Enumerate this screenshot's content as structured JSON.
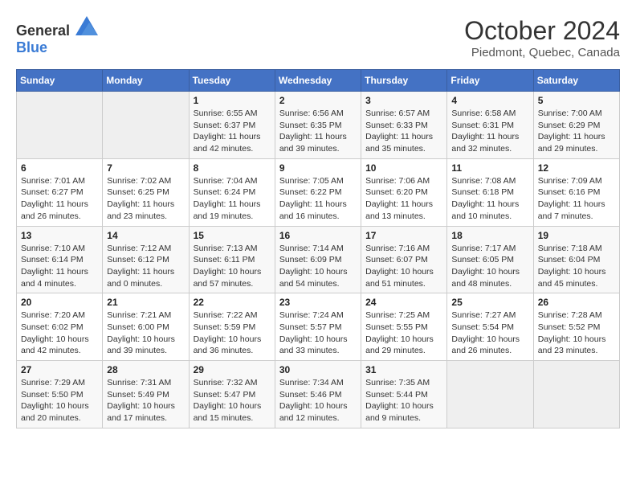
{
  "header": {
    "logo_general": "General",
    "logo_blue": "Blue",
    "month": "October 2024",
    "location": "Piedmont, Quebec, Canada"
  },
  "weekdays": [
    "Sunday",
    "Monday",
    "Tuesday",
    "Wednesday",
    "Thursday",
    "Friday",
    "Saturday"
  ],
  "weeks": [
    [
      {
        "day": "",
        "sunrise": "",
        "sunset": "",
        "daylight": ""
      },
      {
        "day": "",
        "sunrise": "",
        "sunset": "",
        "daylight": ""
      },
      {
        "day": "1",
        "sunrise": "Sunrise: 6:55 AM",
        "sunset": "Sunset: 6:37 PM",
        "daylight": "Daylight: 11 hours and 42 minutes."
      },
      {
        "day": "2",
        "sunrise": "Sunrise: 6:56 AM",
        "sunset": "Sunset: 6:35 PM",
        "daylight": "Daylight: 11 hours and 39 minutes."
      },
      {
        "day": "3",
        "sunrise": "Sunrise: 6:57 AM",
        "sunset": "Sunset: 6:33 PM",
        "daylight": "Daylight: 11 hours and 35 minutes."
      },
      {
        "day": "4",
        "sunrise": "Sunrise: 6:58 AM",
        "sunset": "Sunset: 6:31 PM",
        "daylight": "Daylight: 11 hours and 32 minutes."
      },
      {
        "day": "5",
        "sunrise": "Sunrise: 7:00 AM",
        "sunset": "Sunset: 6:29 PM",
        "daylight": "Daylight: 11 hours and 29 minutes."
      }
    ],
    [
      {
        "day": "6",
        "sunrise": "Sunrise: 7:01 AM",
        "sunset": "Sunset: 6:27 PM",
        "daylight": "Daylight: 11 hours and 26 minutes."
      },
      {
        "day": "7",
        "sunrise": "Sunrise: 7:02 AM",
        "sunset": "Sunset: 6:25 PM",
        "daylight": "Daylight: 11 hours and 23 minutes."
      },
      {
        "day": "8",
        "sunrise": "Sunrise: 7:04 AM",
        "sunset": "Sunset: 6:24 PM",
        "daylight": "Daylight: 11 hours and 19 minutes."
      },
      {
        "day": "9",
        "sunrise": "Sunrise: 7:05 AM",
        "sunset": "Sunset: 6:22 PM",
        "daylight": "Daylight: 11 hours and 16 minutes."
      },
      {
        "day": "10",
        "sunrise": "Sunrise: 7:06 AM",
        "sunset": "Sunset: 6:20 PM",
        "daylight": "Daylight: 11 hours and 13 minutes."
      },
      {
        "day": "11",
        "sunrise": "Sunrise: 7:08 AM",
        "sunset": "Sunset: 6:18 PM",
        "daylight": "Daylight: 11 hours and 10 minutes."
      },
      {
        "day": "12",
        "sunrise": "Sunrise: 7:09 AM",
        "sunset": "Sunset: 6:16 PM",
        "daylight": "Daylight: 11 hours and 7 minutes."
      }
    ],
    [
      {
        "day": "13",
        "sunrise": "Sunrise: 7:10 AM",
        "sunset": "Sunset: 6:14 PM",
        "daylight": "Daylight: 11 hours and 4 minutes."
      },
      {
        "day": "14",
        "sunrise": "Sunrise: 7:12 AM",
        "sunset": "Sunset: 6:12 PM",
        "daylight": "Daylight: 11 hours and 0 minutes."
      },
      {
        "day": "15",
        "sunrise": "Sunrise: 7:13 AM",
        "sunset": "Sunset: 6:11 PM",
        "daylight": "Daylight: 10 hours and 57 minutes."
      },
      {
        "day": "16",
        "sunrise": "Sunrise: 7:14 AM",
        "sunset": "Sunset: 6:09 PM",
        "daylight": "Daylight: 10 hours and 54 minutes."
      },
      {
        "day": "17",
        "sunrise": "Sunrise: 7:16 AM",
        "sunset": "Sunset: 6:07 PM",
        "daylight": "Daylight: 10 hours and 51 minutes."
      },
      {
        "day": "18",
        "sunrise": "Sunrise: 7:17 AM",
        "sunset": "Sunset: 6:05 PM",
        "daylight": "Daylight: 10 hours and 48 minutes."
      },
      {
        "day": "19",
        "sunrise": "Sunrise: 7:18 AM",
        "sunset": "Sunset: 6:04 PM",
        "daylight": "Daylight: 10 hours and 45 minutes."
      }
    ],
    [
      {
        "day": "20",
        "sunrise": "Sunrise: 7:20 AM",
        "sunset": "Sunset: 6:02 PM",
        "daylight": "Daylight: 10 hours and 42 minutes."
      },
      {
        "day": "21",
        "sunrise": "Sunrise: 7:21 AM",
        "sunset": "Sunset: 6:00 PM",
        "daylight": "Daylight: 10 hours and 39 minutes."
      },
      {
        "day": "22",
        "sunrise": "Sunrise: 7:22 AM",
        "sunset": "Sunset: 5:59 PM",
        "daylight": "Daylight: 10 hours and 36 minutes."
      },
      {
        "day": "23",
        "sunrise": "Sunrise: 7:24 AM",
        "sunset": "Sunset: 5:57 PM",
        "daylight": "Daylight: 10 hours and 33 minutes."
      },
      {
        "day": "24",
        "sunrise": "Sunrise: 7:25 AM",
        "sunset": "Sunset: 5:55 PM",
        "daylight": "Daylight: 10 hours and 29 minutes."
      },
      {
        "day": "25",
        "sunrise": "Sunrise: 7:27 AM",
        "sunset": "Sunset: 5:54 PM",
        "daylight": "Daylight: 10 hours and 26 minutes."
      },
      {
        "day": "26",
        "sunrise": "Sunrise: 7:28 AM",
        "sunset": "Sunset: 5:52 PM",
        "daylight": "Daylight: 10 hours and 23 minutes."
      }
    ],
    [
      {
        "day": "27",
        "sunrise": "Sunrise: 7:29 AM",
        "sunset": "Sunset: 5:50 PM",
        "daylight": "Daylight: 10 hours and 20 minutes."
      },
      {
        "day": "28",
        "sunrise": "Sunrise: 7:31 AM",
        "sunset": "Sunset: 5:49 PM",
        "daylight": "Daylight: 10 hours and 17 minutes."
      },
      {
        "day": "29",
        "sunrise": "Sunrise: 7:32 AM",
        "sunset": "Sunset: 5:47 PM",
        "daylight": "Daylight: 10 hours and 15 minutes."
      },
      {
        "day": "30",
        "sunrise": "Sunrise: 7:34 AM",
        "sunset": "Sunset: 5:46 PM",
        "daylight": "Daylight: 10 hours and 12 minutes."
      },
      {
        "day": "31",
        "sunrise": "Sunrise: 7:35 AM",
        "sunset": "Sunset: 5:44 PM",
        "daylight": "Daylight: 10 hours and 9 minutes."
      },
      {
        "day": "",
        "sunrise": "",
        "sunset": "",
        "daylight": ""
      },
      {
        "day": "",
        "sunrise": "",
        "sunset": "",
        "daylight": ""
      }
    ]
  ]
}
